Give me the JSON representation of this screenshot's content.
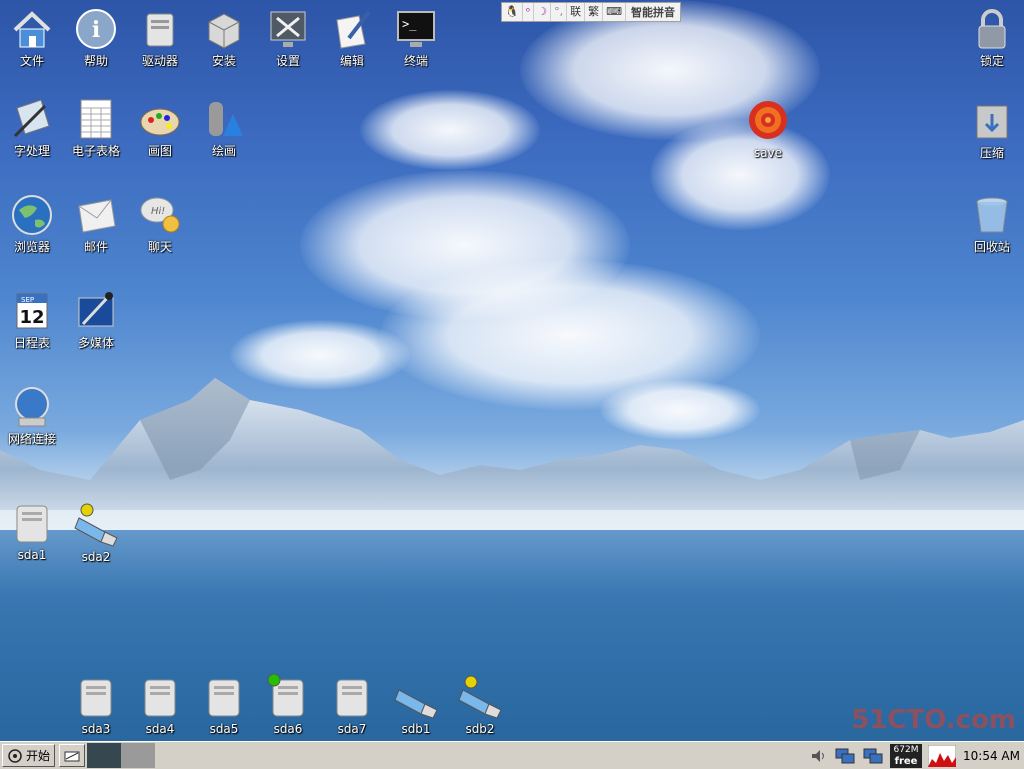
{
  "desktop": {
    "icons_left": [
      {
        "label": "文件",
        "icon": "home-folder-icon"
      },
      {
        "label": "帮助",
        "icon": "help-info-icon"
      },
      {
        "label": "驱动器",
        "icon": "drive-icon"
      },
      {
        "label": "安装",
        "icon": "package-box-icon"
      },
      {
        "label": "设置",
        "icon": "settings-tools-icon"
      },
      {
        "label": "编辑",
        "icon": "text-editor-icon"
      },
      {
        "label": "终端",
        "icon": "terminal-icon"
      },
      {
        "label": "字处理",
        "icon": "word-processor-icon"
      },
      {
        "label": "电子表格",
        "icon": "spreadsheet-icon"
      },
      {
        "label": "画图",
        "icon": "paint-palette-icon"
      },
      {
        "label": "绘画",
        "icon": "drawing-shapes-icon"
      },
      {
        "label": "浏览器",
        "icon": "globe-browser-icon"
      },
      {
        "label": "邮件",
        "icon": "mail-icon"
      },
      {
        "label": "聊天",
        "icon": "chat-bubble-icon"
      },
      {
        "label": "日程表",
        "icon": "calendar-icon"
      },
      {
        "label": "多媒体",
        "icon": "multimedia-icon"
      },
      {
        "label": "网络连接",
        "icon": "network-globe-icon"
      }
    ],
    "calendar_icon": {
      "month": "SEP",
      "day": "12"
    },
    "save_icon": {
      "label": "save",
      "icon": "save-target-icon"
    },
    "icons_right": [
      {
        "label": "锁定",
        "icon": "lock-icon"
      },
      {
        "label": "压缩",
        "icon": "compress-icon"
      },
      {
        "label": "回收站",
        "icon": "trash-icon"
      }
    ],
    "drives": [
      {
        "label": "sda1",
        "icon": "hard-drive-icon",
        "mounted": false
      },
      {
        "label": "sda2",
        "icon": "usb-drive-icon",
        "mounted": true,
        "dot": "#e6d200"
      },
      {
        "label": "sda3",
        "icon": "hard-drive-icon",
        "mounted": false
      },
      {
        "label": "sda4",
        "icon": "hard-drive-icon",
        "mounted": false
      },
      {
        "label": "sda5",
        "icon": "hard-drive-icon",
        "mounted": false
      },
      {
        "label": "sda6",
        "icon": "hard-drive-icon",
        "mounted": true,
        "dot": "#22c000"
      },
      {
        "label": "sda7",
        "icon": "hard-drive-icon",
        "mounted": false
      },
      {
        "label": "sdb1",
        "icon": "usb-drive-icon",
        "mounted": false
      },
      {
        "label": "sdb2",
        "icon": "usb-drive-icon",
        "mounted": true,
        "dot": "#e6d200"
      }
    ]
  },
  "ime_bar": {
    "name": "智能拼音",
    "keys": [
      "联",
      "繁"
    ]
  },
  "taskbar": {
    "start_label": "开始",
    "tray": {
      "memory_value": "672M",
      "memory_label": "free",
      "clock": "10:54 AM"
    }
  },
  "watermark": {
    "text": "51CTO.com"
  },
  "colors": {
    "taskbar": "#d4d0c8",
    "sky_top": "#2d55a8",
    "water": "#2f6ea8"
  }
}
